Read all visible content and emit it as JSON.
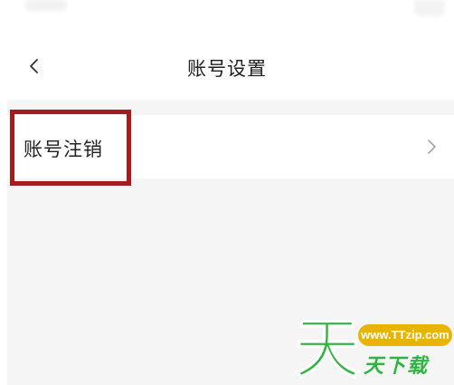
{
  "nav": {
    "back_icon": "chevron-left-icon",
    "title": "账号设置"
  },
  "settings": {
    "items": [
      {
        "label": "账号注销",
        "icon": "chevron-right-icon"
      }
    ]
  },
  "highlight": {
    "color": "#a61b1b"
  },
  "watermark": {
    "logo_char": "天",
    "url": "www.TTzip.com",
    "text": "天下载",
    "brand_color": "#2fb342",
    "url_color": "#e8b400"
  }
}
